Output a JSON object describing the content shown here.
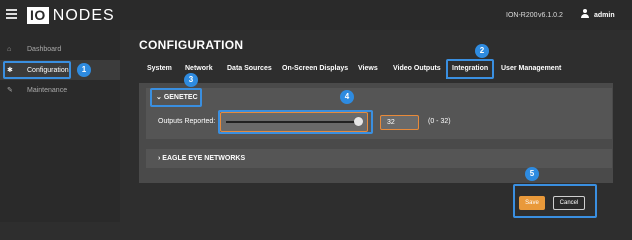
{
  "header": {
    "brand_box": "IO",
    "brand_text": "NODES",
    "model": "ION-R200",
    "version": "v6.1.0.2",
    "user": "admin"
  },
  "sidebar": {
    "items": [
      {
        "label": "Dashboard",
        "icon": "home-icon",
        "glyph": "⌂"
      },
      {
        "label": "Configuration",
        "icon": "gear-icon",
        "glyph": "✱"
      },
      {
        "label": "Maintenance",
        "icon": "wrench-icon",
        "glyph": "✎"
      }
    ]
  },
  "main": {
    "title": "CONFIGURATION",
    "tabs": [
      "System",
      "Network",
      "Data Sources",
      "On-Screen Displays",
      "Views",
      "Video Outputs",
      "Integration",
      "User Management"
    ],
    "active_tab": "Integration",
    "genetec": {
      "header": "GENETEC",
      "outputs_label": "Outputs Reported:",
      "outputs_value": "32",
      "range_hint": "(0 - 32)",
      "slider_fraction": 1.0
    },
    "eagle_eye": {
      "header": "EAGLE EYE NETWORKS"
    }
  },
  "footer": {
    "save": "Save",
    "cancel": "Cancel"
  },
  "annotations": [
    "1",
    "2",
    "3",
    "4",
    "5"
  ],
  "colors": {
    "accent": "#e9993a",
    "highlight": "#3a8fe0",
    "active_tab_line": "#3aa0e6"
  }
}
